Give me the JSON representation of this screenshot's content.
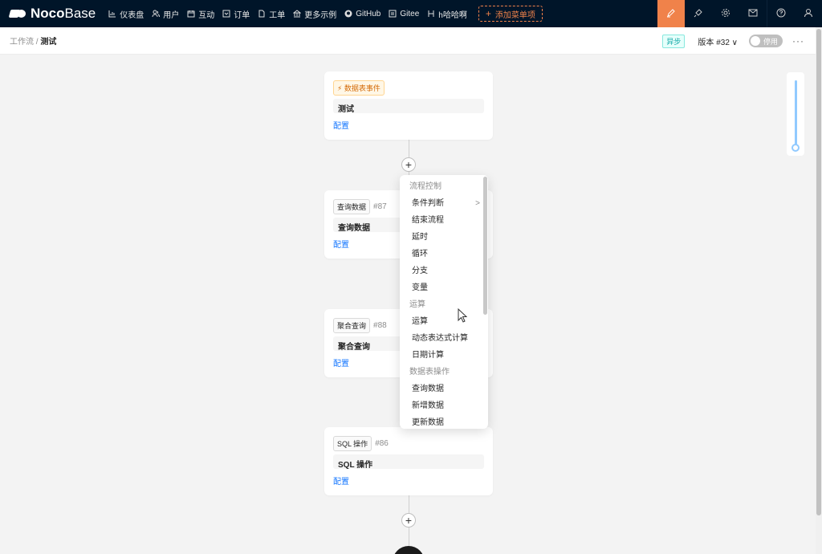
{
  "brand": {
    "bold": "Noco",
    "light": "Base"
  },
  "menu": [
    {
      "label": "仪表盘",
      "icon": "bar-chart-icon"
    },
    {
      "label": "用户",
      "icon": "users-icon"
    },
    {
      "label": "互动",
      "icon": "calendar-icon"
    },
    {
      "label": "订单",
      "icon": "order-icon"
    },
    {
      "label": "工单",
      "icon": "file-icon"
    },
    {
      "label": "更多示例",
      "icon": "bank-icon"
    },
    {
      "label": "GitHub",
      "icon": "github-icon"
    },
    {
      "label": "Gitee",
      "icon": "gitee-icon"
    },
    {
      "label": "h哈哈啊",
      "icon": "h-icon"
    }
  ],
  "add_menu_label": "添加菜单项",
  "top_right_icons": [
    "ui-editor-icon",
    "plugin-icon",
    "settings-icon",
    "mail-icon",
    "help-icon",
    "user-icon"
  ],
  "breadcrumb": {
    "parent": "工作流",
    "separator": " / ",
    "current": "测试"
  },
  "header": {
    "mode_badge": "异步",
    "version": "版本 #32",
    "toggle_label": "停用",
    "more": "···"
  },
  "nodes": [
    {
      "tag": "数据表事件",
      "number": "",
      "title": "测试",
      "config": "配置"
    },
    {
      "tag": "查询数据",
      "number": "#87",
      "title": "查询数据",
      "config": "配置"
    },
    {
      "tag": "聚合查询",
      "number": "#88",
      "title": "聚合查询",
      "config": "配置"
    },
    {
      "tag": "SQL 操作",
      "number": "#86",
      "title": "SQL 操作",
      "config": "配置"
    }
  ],
  "add_node_symbol": "+",
  "dropdown": {
    "groups": [
      {
        "label": "流程控制",
        "items": [
          "条件判断",
          "结束流程",
          "延时",
          "循环",
          "分支",
          "变量"
        ]
      },
      {
        "label": "运算",
        "items": [
          "运算",
          "动态表达式计算",
          "日期计算"
        ]
      },
      {
        "label": "数据表操作",
        "items": [
          "查询数据",
          "新增数据",
          "更新数据"
        ]
      }
    ],
    "submenu_indicator": ">"
  },
  "colors": {
    "topbar": "#001529",
    "accent": "#f0824a",
    "link": "#1677ff"
  }
}
